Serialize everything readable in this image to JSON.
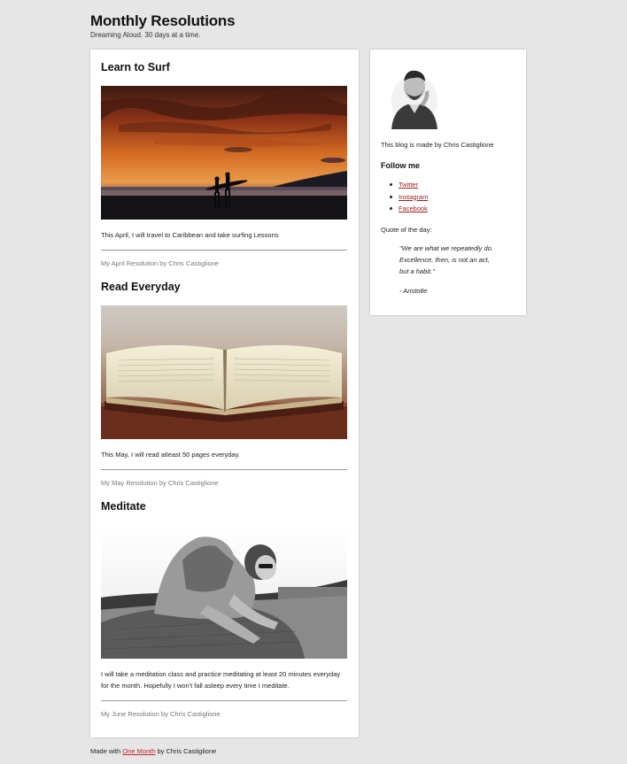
{
  "header": {
    "title": "Monthly Resolutions",
    "tagline": "Dreaming Aloud. 30 days at a time."
  },
  "posts": [
    {
      "title": "Learn to Surf",
      "image": "surf-sunset-photo",
      "body": "This April, I will travel to Caribbean and take surfing Lessons",
      "byline": "My April Resolution by Chris Castiglione"
    },
    {
      "title": "Read Everyday",
      "image": "open-book-photo",
      "body": "This May, I will read atleast 50 pages everyday.",
      "byline": "My May Resolution by Chris Castiglione"
    },
    {
      "title": "Meditate",
      "image": "woman-on-hay-bale-photo",
      "body": "I will take a meditation class and practice meditating at least 20 minutes everyday for the month. Hopefully I won't fall asleep every time I meditate.",
      "byline": "My June Resolution by Chris Castiglione"
    }
  ],
  "sidebar": {
    "avatar": "author-portrait-photo",
    "made_by": "This blog is made by Chris Castiglione",
    "follow_heading": "Follow me",
    "links": [
      {
        "label": "Twitter"
      },
      {
        "label": "Instagram"
      },
      {
        "label": "Facebook"
      }
    ],
    "quote_label": "Quote of the day:",
    "quote": "\"We are what we repeatedly do. Excellence, then, is not an act, but a habit.\"",
    "quote_author": "- Aristotle"
  },
  "footer": {
    "prefix": "Made with ",
    "link": "One Month",
    "suffix": " by Chris Castiglione"
  },
  "colors": {
    "background": "#e6e6e6",
    "link": "#a31f1f",
    "footer_link": "#c0272d"
  }
}
